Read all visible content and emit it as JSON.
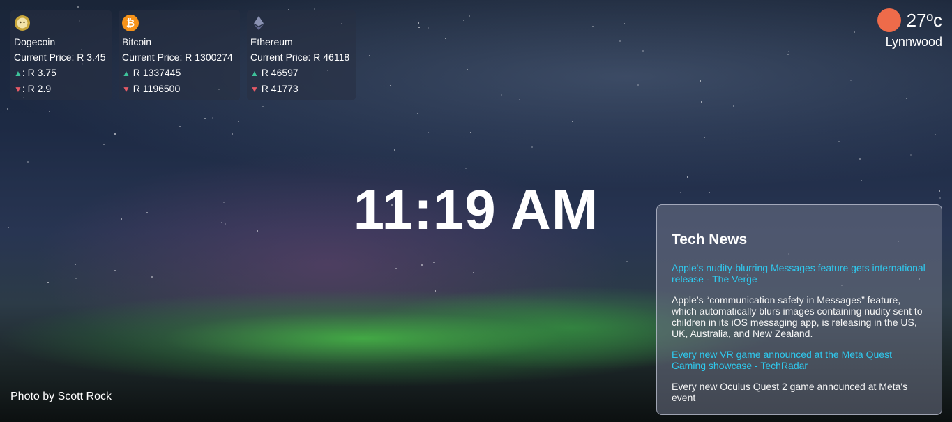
{
  "crypto": [
    {
      "name": "Dogecoin",
      "price_label": "Current Price: R 3.45",
      "high": ": R 3.75",
      "low": ": R 2.9",
      "icon": "dogecoin-icon",
      "color": "#c9a63a"
    },
    {
      "name": "Bitcoin",
      "price_label": "Current Price: R 1300274",
      "high": " R 1337445",
      "low": " R 1196500",
      "icon": "bitcoin-icon",
      "color": "#f7931a"
    },
    {
      "name": "Ethereum",
      "price_label": "Current Price: R 46118",
      "high": " R 46597",
      "low": " R 41773",
      "icon": "ethereum-icon",
      "color": "#8a92b2"
    }
  ],
  "arrows": {
    "up": "▲",
    "down": "▼"
  },
  "weather": {
    "temperature": "27ºc",
    "location": "Lynnwood",
    "icon": "sun-icon",
    "icon_color": "#ee6b4a"
  },
  "clock": {
    "time": "11:19 AM"
  },
  "credit": {
    "text": "Photo by Scott Rock"
  },
  "news": {
    "title": "Tech News",
    "items": [
      {
        "headline": "Apple's nudity-blurring Messages feature gets international release - The Verge",
        "summary": "Apple’s “communication safety in Messages” feature, which automatically blurs images containing nudity sent to children in its iOS messaging app, is releasing in the US, UK, Australia, and New Zealand."
      },
      {
        "headline": "Every new VR game announced at the Meta Quest Gaming showcase - TechRadar",
        "summary": "Every new Oculus Quest 2 game announced at Meta's event"
      }
    ]
  },
  "colors": {
    "link": "#2fc9ee",
    "up": "#3ec39a",
    "down": "#e55a66"
  }
}
